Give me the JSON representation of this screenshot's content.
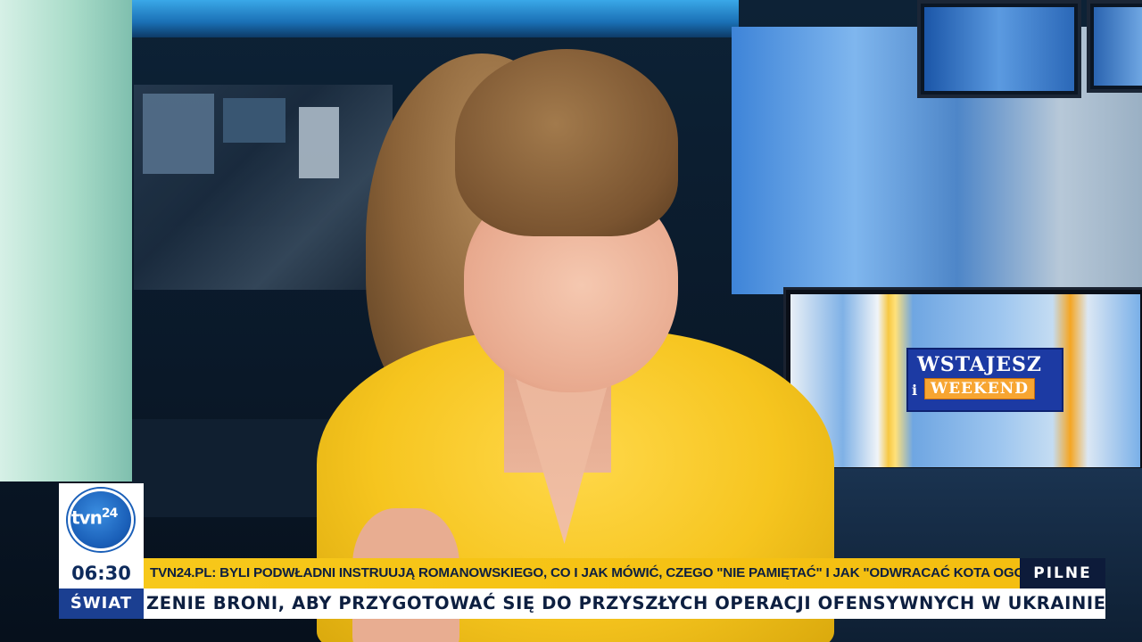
{
  "channel": {
    "logo_text": "tvn",
    "logo_number": "24"
  },
  "show_logo": {
    "line1": "WSTAJESZ",
    "line2": "i",
    "line3": "WEEKEND"
  },
  "lower_third": {
    "time": "06:30",
    "section": "ŚWIAT",
    "headline": "TVN24.PL: BYLI PODWŁADNI INSTRUUJĄ ROMANOWSKIEGO, CO I JAK MÓWIĆ, CZEGO \"NIE PAMIĘTAĆ\" I JAK \"ODWRACAĆ KOTA OGONEM\"",
    "badge": "PILNE",
    "ticker": "ZENIE BRONI, ABY PRZYGOTOWAĆ SIĘ DO PRZYSZŁYCH OPERACJI OFENSYWNYCH W UKRAINIE"
  },
  "colors": {
    "headline_bg": "#f7c81a",
    "badge_bg": "#0d1b3a",
    "section_bg": "#1b3f91",
    "ticker_bg": "#ffffff",
    "brand_blue": "#1a5fb8"
  }
}
